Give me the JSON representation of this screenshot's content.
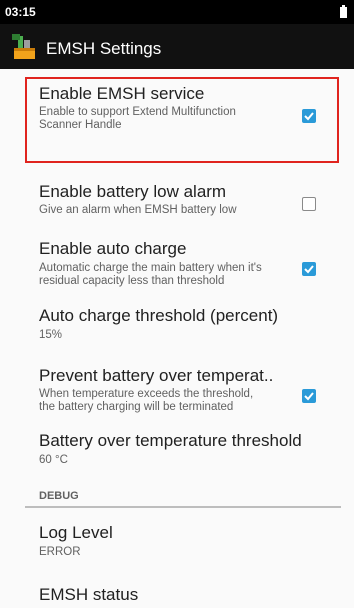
{
  "status_bar": {
    "time": "03:15",
    "battery_icon": "battery-full-icon"
  },
  "app_bar": {
    "title": "EMSH Settings",
    "app_icon": "emsh-app-icon"
  },
  "preferences": [
    {
      "title": "Enable EMSH service",
      "summary": "Enable to support Extend Multifunction Scanner Handle",
      "checked": true
    },
    {
      "title": "Enable battery low alarm",
      "summary": "Give an alarm when EMSH battery low",
      "checked": false
    },
    {
      "title": "Enable auto charge",
      "summary": "Automatic charge the main battery when it's residual capacity less than threshold",
      "checked": true
    },
    {
      "title": "Auto charge threshold (percent)",
      "summary": "15%"
    },
    {
      "title": "Prevent battery over temperat..",
      "summary": "When temperature exceeds the threshold, the battery charging will be terminated",
      "checked": true
    },
    {
      "title": "Battery over temperature threshold",
      "summary": "60 °C"
    }
  ],
  "debug": {
    "header": "DEBUG",
    "items": [
      {
        "title": "Log Level",
        "summary": "ERROR"
      },
      {
        "title": "EMSH status"
      }
    ]
  },
  "colors": {
    "checkbox_checked": "#2a9ad8",
    "highlight": "#e0241e"
  }
}
